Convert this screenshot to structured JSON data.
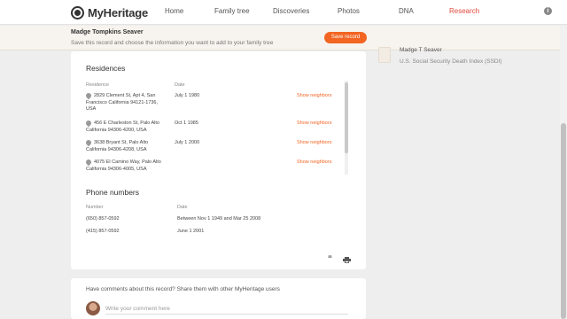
{
  "brand": {
    "name": "MyHeritage"
  },
  "nav": {
    "items": [
      {
        "label": "Home"
      },
      {
        "label": "Family tree"
      },
      {
        "label": "Discoveries"
      },
      {
        "label": "Photos"
      },
      {
        "label": "DNA"
      },
      {
        "label": "Research"
      }
    ],
    "active": "Research"
  },
  "save_bar": {
    "name": "Madge Tompkins Seaver",
    "subtitle": "Save this record and choose the information you want to add to your family tree",
    "button_label": "Save record"
  },
  "residences": {
    "title": "Residences",
    "col_residence": "Residence",
    "col_date": "Date",
    "rows": [
      {
        "address": "2829 Clement St, Apt 4, San Francisco California 94121-1736, USA",
        "date": "July 1 1980",
        "action": "Show neighbors"
      },
      {
        "address": "456 E Charleston St, Palo Alto California 94306-4200, USA",
        "date": "Oct 1 1985",
        "action": "Show neighbors"
      },
      {
        "address": "3638 Bryant St, Palo Alto California 94306-4208, USA",
        "date": "July 1 2000",
        "action": "Show neighbors"
      },
      {
        "address": "4075 El Camino Way, Palo Alto California 94306-4005, USA",
        "date": "",
        "action": "Show neighbors"
      }
    ]
  },
  "phones": {
    "title": "Phone numbers",
    "col_number": "Number",
    "col_date": "Date",
    "rows": [
      {
        "number": "(650) 857-0592",
        "date": "Between Nov 1 1949 and Mar 25 2008"
      },
      {
        "number": "(415) 857-0592",
        "date": "June 1 2001"
      }
    ]
  },
  "comments": {
    "title": "Have comments about this record? Share them with other MyHeritage users",
    "placeholder": "Write your comment here"
  },
  "related_record": {
    "name": "Madge T Seaver",
    "source": "U.S. Social Security Death Index (SSDI)"
  },
  "colors": {
    "accent": "#f26522",
    "research": "#e2483d"
  }
}
